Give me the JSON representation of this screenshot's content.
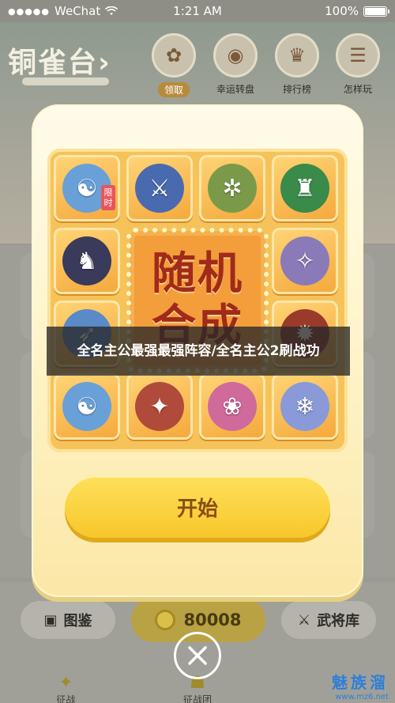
{
  "status_bar": {
    "carrier": "WeChat",
    "time": "1:21 AM",
    "battery": "100%",
    "battery_level": 1.0
  },
  "background": {
    "title": "铜雀台",
    "title_arrow": "›",
    "nav": [
      {
        "label": "领取",
        "icon": "gift-bag-icon",
        "highlighted": true
      },
      {
        "label": "幸运转盘",
        "icon": "lucky-wheel-icon",
        "highlighted": false
      },
      {
        "label": "排行榜",
        "icon": "ranking-icon",
        "highlighted": false
      },
      {
        "label": "怎样玩",
        "icon": "scroll-icon",
        "highlighted": false
      }
    ],
    "bottom": {
      "gallery_label": "图鉴",
      "coins": "80008",
      "armory_label": "武将库"
    },
    "tabs": [
      {
        "label": "征战",
        "icon": "battle-icon"
      },
      {
        "label": "征战团",
        "icon": "team-icon"
      }
    ]
  },
  "modal": {
    "limited_tag": "限时",
    "center_title": "随机合成",
    "center_title_lines": [
      "随机",
      "合成"
    ],
    "start_label": "开始",
    "heroes": [
      {
        "icon": "strategist-hero-icon",
        "color": "#6aa0d8"
      },
      {
        "icon": "swordsman-hero-icon",
        "color": "#4a6ab0"
      },
      {
        "icon": "beast-hero-icon",
        "color": "#7a9a4a"
      },
      {
        "icon": "red-general-hero-icon",
        "color": "#3a8a4a"
      },
      {
        "icon": "dark-warrior-hero-icon",
        "color": "#3a3a5a"
      },
      {
        "icon": "knight-hero-icon",
        "color": "#8a7ab8"
      },
      {
        "icon": "archer-hero-icon",
        "color": "#5a8ac8"
      },
      {
        "icon": "fire-warrior-hero-icon",
        "color": "#9a3a2a"
      },
      {
        "icon": "strategist-hero-icon",
        "color": "#6aa0d8"
      },
      {
        "icon": "spear-hero-icon",
        "color": "#b04a3a"
      },
      {
        "icon": "maiden-hero-icon",
        "color": "#d06a9a"
      },
      {
        "icon": "blue-hair-hero-icon",
        "color": "#8a9ad8"
      }
    ]
  },
  "caption": "全名主公最强最强阵容/全名主公2刷战功",
  "watermark": {
    "title": "魅族溜",
    "url": "www.mz6.net"
  },
  "colors": {
    "modal_bg": "#fff4c9",
    "grid_bg": "#f6c35a",
    "start_button": "#f7c72a",
    "center_text": "#a12a1a"
  }
}
